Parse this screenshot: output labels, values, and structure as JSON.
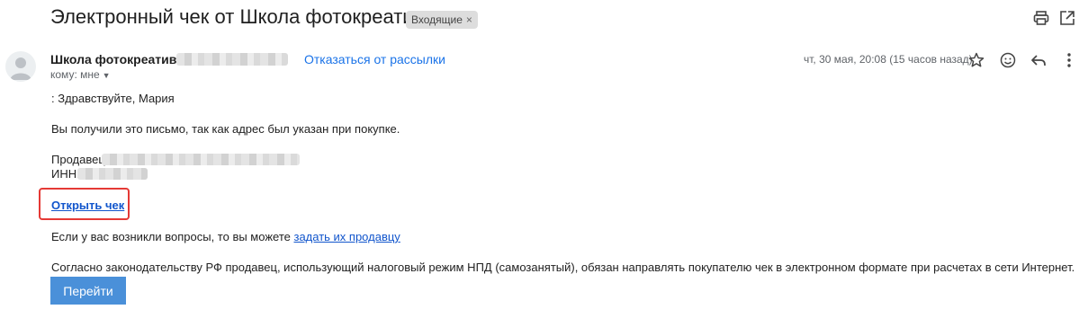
{
  "email": {
    "subject": "Электронный чек от Школа фотокреатива т",
    "label": "Входящие",
    "label_remove": "×",
    "sender_name": "Школа фотокреатива т",
    "unsubscribe": "Отказаться от рассылки",
    "to_prefix": "кому: мне",
    "date": "чт, 30 мая, 20:08 (15 часов назад)"
  },
  "body": {
    "greeting": ": Здравствуйте, Мария",
    "reason": "Вы получили это письмо, так как адрес был указан при покупке.",
    "seller_label": "Продавец:",
    "inn_label": "ИНН:",
    "open_check": "Открыть чек",
    "questions_prefix": "Если у вас возникли вопросы, то вы можете ",
    "questions_link": "задать их продавцу",
    "law_text": "Согласно законодательству РФ продавец, использующий налоговый режим НПД (самозанятый), обязан направлять покупателю чек в электронном формате при расчетах в сети Интернет.",
    "go_button": "Перейти"
  },
  "icons": {
    "print": "print-icon",
    "open_new_window": "open-in-new-window-icon",
    "star": "star-icon",
    "emoji": "emoji-icon",
    "reply": "reply-icon",
    "more": "more-vert-icon",
    "avatar": "avatar-icon",
    "caret": "caret-down-icon"
  },
  "colors": {
    "link": "#1155cc",
    "unsubscribe": "#1a73e8",
    "highlight": "#e53935",
    "button": "#4a90d9"
  }
}
